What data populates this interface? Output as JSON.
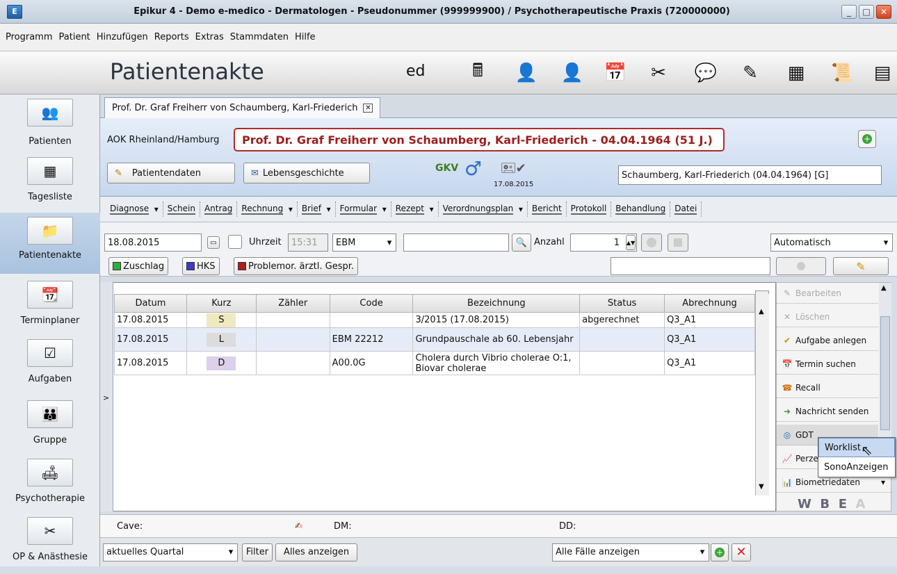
{
  "window": {
    "title": "Epikur 4 - Demo e-medico - Dermatologen - Pseudonummer (999999900) / Psychotherapeutische Praxis (720000000)"
  },
  "menu": [
    "Programm",
    "Patient",
    "Hinzufügen",
    "Reports",
    "Extras",
    "Stammdaten",
    "Hilfe"
  ],
  "header": {
    "title": "Patientenakte",
    "user": "ed"
  },
  "sidebar": [
    {
      "label": "Patienten"
    },
    {
      "label": "Tagesliste"
    },
    {
      "label": "Patientenakte"
    },
    {
      "label": "Terminplaner"
    },
    {
      "label": "Aufgaben"
    },
    {
      "label": "Gruppe"
    },
    {
      "label": "Psychotherapie"
    },
    {
      "label": "OP & Anästhesie"
    }
  ],
  "tab": {
    "label": "Prof. Dr. Graf Freiherr von Schaumberg, Karl-Friederich"
  },
  "patient": {
    "kasse": "AOK Rheinland/Hamburg",
    "fullname": "Prof. Dr. Graf Freiherr von Schaumberg, Karl-Friederich - 04.04.1964  (51 J.)",
    "btn_patientendaten": "Patientendaten",
    "btn_lebensgeschichte": "Lebensgeschichte",
    "gkv": "GKV",
    "gender": "♂",
    "sync_date": "17.08.2015",
    "alias": "Schaumberg, Karl-Friederich (04.04.1964) [G]"
  },
  "actions": [
    "Diagnose",
    "Schein",
    "Antrag",
    "Rechnung",
    "Brief",
    "Formular",
    "Rezept",
    "Verordnungsplan",
    "Bericht",
    "Protokoll",
    "Behandlung",
    "Datei"
  ],
  "entry": {
    "date": "18.08.2015",
    "uhrzeit_label": "Uhrzeit",
    "uhrzeit": "15:31",
    "katalog": "EBM",
    "anzahl_label": "Anzahl",
    "anzahl": "1",
    "mode": "Automatisch",
    "chip1": "Zuschlag",
    "chip2": "HKS",
    "chip3": "Problemor. ärztl. Gespr."
  },
  "table": {
    "headers": [
      "Datum",
      "Kurz",
      "Zähler",
      "Code",
      "Bezeichnung",
      "Status",
      "Abrechnung"
    ],
    "rows": [
      {
        "datum": "17.08.2015",
        "kurz": "S",
        "zaehler": "",
        "code": "",
        "bez": "3/2015 (17.08.2015)",
        "status": "abgerechnet",
        "abr": "Q3_A1"
      },
      {
        "datum": "17.08.2015",
        "kurz": "L",
        "zaehler": "",
        "code": "EBM 22212",
        "bez": "Grundpauschale ab 60. Lebensjahr",
        "status": "",
        "abr": "Q3_A1"
      },
      {
        "datum": "17.08.2015",
        "kurz": "D",
        "zaehler": "",
        "code": "A00.0G",
        "bez": "Cholera durch Vibrio cholerae O:1, Biovar cholerae",
        "status": "",
        "abr": "Q3_A1"
      }
    ]
  },
  "right_panel": [
    "Bearbeiten",
    "Löschen",
    "Aufgabe anlegen",
    "Termin suchen",
    "Recall",
    "Nachricht senden",
    "GDT",
    "Perze",
    "Biometriedaten"
  ],
  "wbe": [
    "W",
    "B",
    "E",
    "A"
  ],
  "popup": [
    "Worklist",
    "SonoAnzeigen"
  ],
  "cave": {
    "cave": "Cave:",
    "dm": "DM:",
    "dd": "DD:"
  },
  "bottom": {
    "quartal": "aktuelles Quartal",
    "filter": "Filter",
    "alles": "Alles anzeigen",
    "faelle": "Alle Fälle anzeigen"
  },
  "colors": {
    "accent_red": "#9c1e1e",
    "gkv_green": "#3a7d1e",
    "chip_green": "#2fae3a",
    "chip_blue": "#3a3ad0",
    "chip_red": "#b11e1e"
  }
}
